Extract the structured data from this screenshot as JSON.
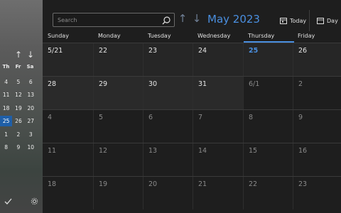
{
  "sidebar": {
    "mini_headers": [
      "Th",
      "Fr",
      "Sa"
    ],
    "mini_rows": [
      [
        "4",
        "5",
        "6"
      ],
      [
        "11",
        "12",
        "13"
      ],
      [
        "18",
        "19",
        "20"
      ],
      [
        "25",
        "26",
        "27"
      ],
      [
        "1",
        "2",
        "3"
      ],
      [
        "8",
        "9",
        "10"
      ]
    ],
    "selected_day": "25"
  },
  "search": {
    "placeholder": "Search"
  },
  "header": {
    "month_title": "May 2023",
    "today_label": "Today",
    "day_label": "Day"
  },
  "weekdays": [
    "Sunday",
    "Monday",
    "Tuesday",
    "Wednesday",
    "Thursday",
    "Friday"
  ],
  "weeks": [
    [
      "5/21",
      "22",
      "23",
      "24",
      "25",
      "26"
    ],
    [
      "28",
      "29",
      "30",
      "31",
      "6/1",
      "2"
    ],
    [
      "4",
      "5",
      "6",
      "7",
      "8",
      "9"
    ],
    [
      "11",
      "12",
      "13",
      "14",
      "15",
      "16"
    ],
    [
      "18",
      "19",
      "20",
      "21",
      "22",
      "23"
    ]
  ],
  "today": "25",
  "colors": {
    "accent": "#4a8fe0",
    "background": "#1e1e1e",
    "selected": "#1f5fa8"
  }
}
